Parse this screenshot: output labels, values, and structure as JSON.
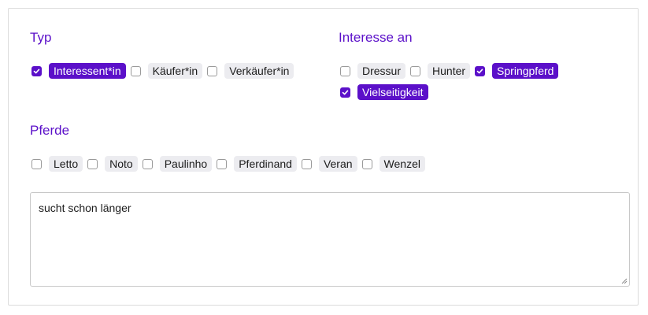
{
  "typ": {
    "title": "Typ",
    "options": [
      {
        "label": "Interessent*in",
        "checked": true
      },
      {
        "label": "Käufer*in",
        "checked": false
      },
      {
        "label": "Verkäufer*in",
        "checked": false
      }
    ]
  },
  "interesse": {
    "title": "Interesse an",
    "options": [
      {
        "label": "Dressur",
        "checked": false
      },
      {
        "label": "Hunter",
        "checked": false
      },
      {
        "label": "Springpferd",
        "checked": true
      },
      {
        "label": "Vielseitigkeit",
        "checked": true
      }
    ]
  },
  "pferde": {
    "title": "Pferde",
    "options": [
      {
        "label": "Letto",
        "checked": false
      },
      {
        "label": "Noto",
        "checked": false
      },
      {
        "label": "Paulinho",
        "checked": false
      },
      {
        "label": "Pferdinand",
        "checked": false
      },
      {
        "label": "Veran",
        "checked": false
      },
      {
        "label": "Wenzel",
        "checked": false
      }
    ]
  },
  "notes": {
    "value": "sucht schon länger"
  },
  "colors": {
    "accent": "#5b10c9",
    "chip_bg": "#ececf0"
  }
}
